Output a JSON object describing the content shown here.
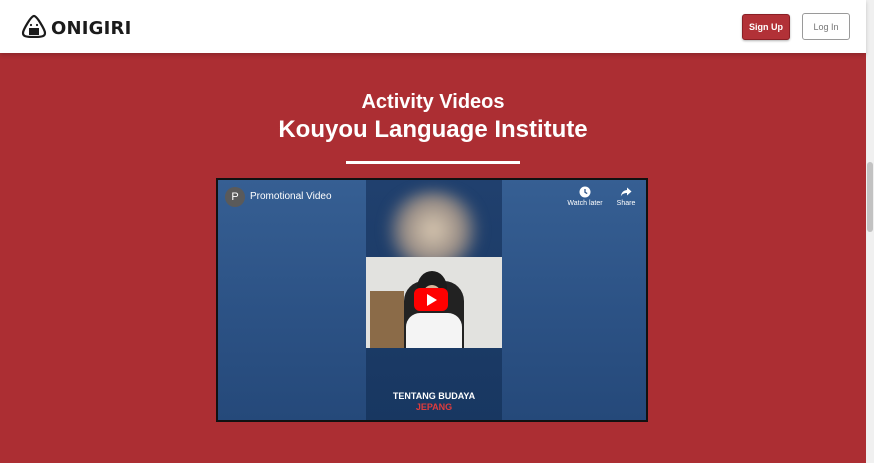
{
  "nav": {
    "brand": "ONIGIRI",
    "signup_label": "Sign Up",
    "login_label": "Log In"
  },
  "hero": {
    "subtitle": "Activity Videos",
    "title": "Kouyou Language Institute"
  },
  "video": {
    "channel_initial": "P",
    "title": "Promotional Video",
    "watch_later_label": "Watch later",
    "share_label": "Share",
    "caption_line1": "TENTANG BUDAYA",
    "caption_line2": "JEPANG"
  },
  "colors": {
    "brand_red": "#ac2e33",
    "play_red": "#ff0000"
  }
}
